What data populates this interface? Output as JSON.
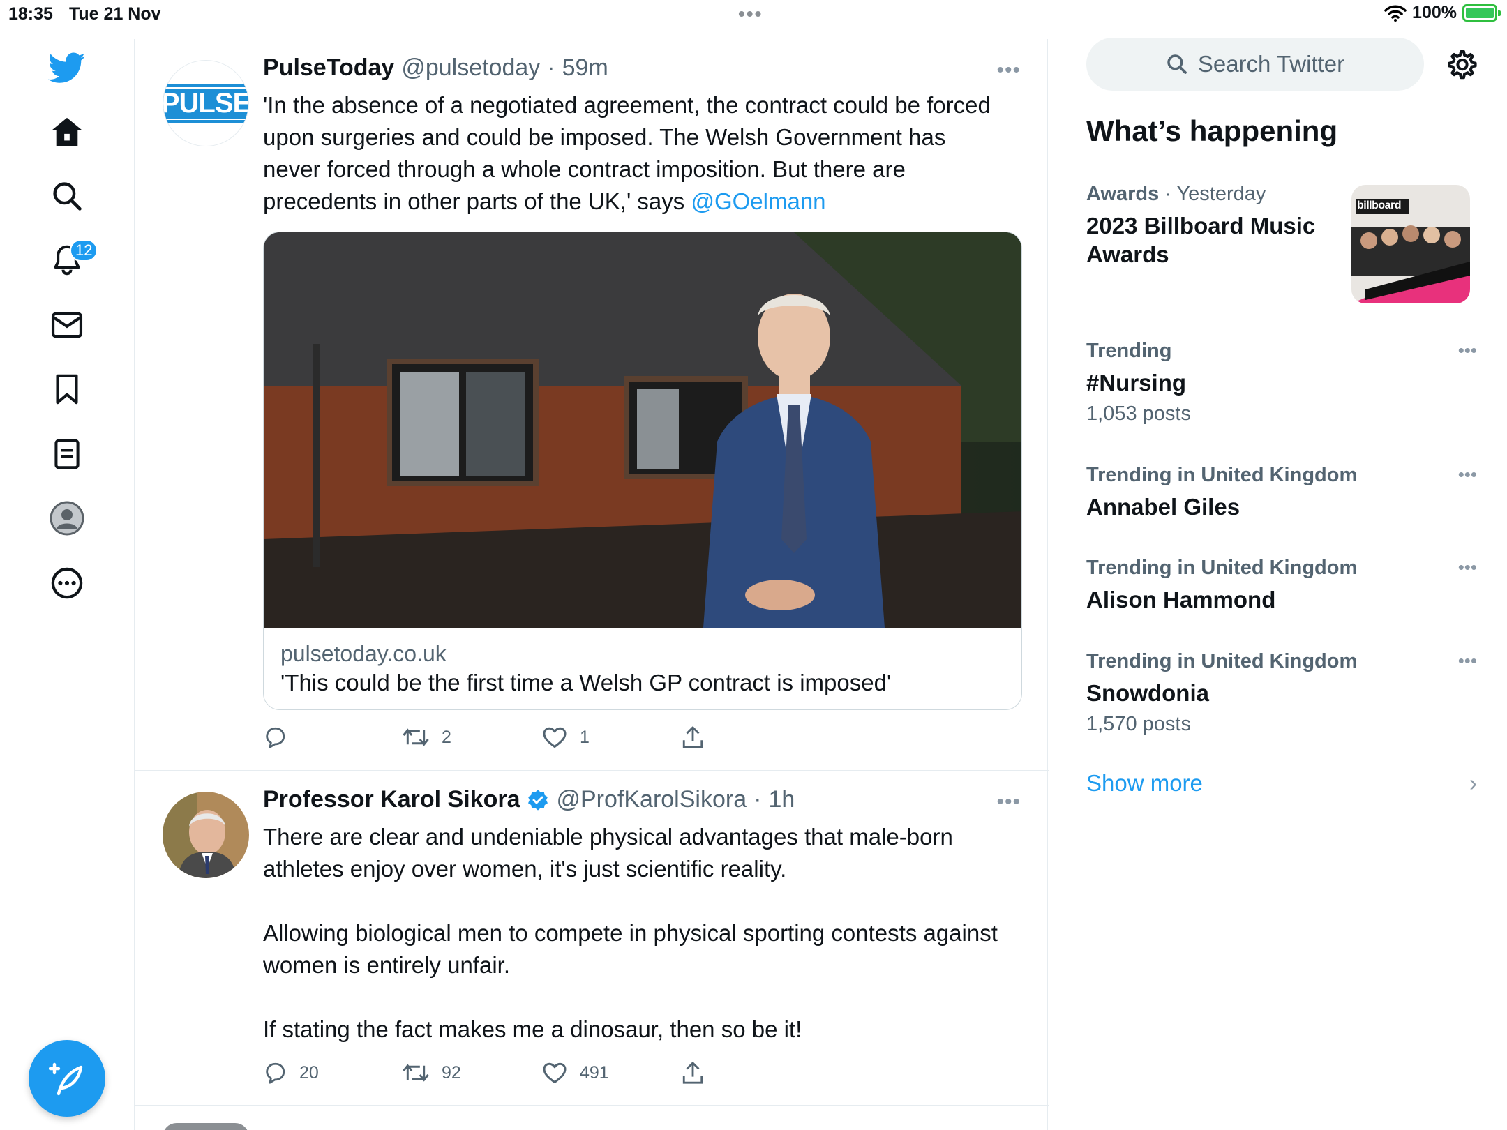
{
  "status_bar": {
    "time": "18:35",
    "date": "Tue 21 Nov",
    "battery": "100%"
  },
  "nav": {
    "notifications_badge": "12"
  },
  "tweets": [
    {
      "name": "PulseToday",
      "handle": "@pulsetoday",
      "time": "59m",
      "avatar_text": "PULSE",
      "text": "'In the absence of a negotiated agreement, the contract could be forced upon surgeries and could be imposed. The Welsh Government has never forced through a whole contract imposition. But there are precedents in other parts of the UK,' says ",
      "mention": "@GOelmann",
      "card_domain": "pulsetoday.co.uk",
      "card_title": "'This could be the first time a Welsh GP contract is imposed'",
      "replies": "",
      "retweets": "2",
      "likes": "1"
    },
    {
      "name": "Professor Karol Sikora",
      "handle": "@ProfKarolSikora",
      "time": "1h",
      "para1": "There are clear and undeniable physical advantages that male-born athletes enjoy over women, it's just scientific reality.",
      "para2": "Allowing biological men to compete in physical sporting contests against women is entirely unfair.",
      "para3": "If stating the fact makes me a dinosaur, then so be it!",
      "replies": "20",
      "retweets": "92",
      "likes": "491"
    }
  ],
  "sidebar": {
    "search_placeholder": "Search Twitter",
    "title": "What’s happening",
    "trends": [
      {
        "category": "Awards",
        "when": "Yesterday",
        "title": "2023 Billboard Music Awards",
        "thumb_text": "billboard"
      },
      {
        "category": "Trending",
        "title": "#Nursing",
        "count": "1,053 posts"
      },
      {
        "category": "Trending in United Kingdom",
        "title": "Annabel Giles"
      },
      {
        "category": "Trending in United Kingdom",
        "title": "Alison Hammond"
      },
      {
        "category": "Trending in United Kingdom",
        "title": "Snowdonia",
        "count": "1,570 posts"
      }
    ],
    "show_more": "Show more"
  },
  "colors": {
    "accent": "#1d9bf0",
    "text": "#0f1419",
    "muted": "#536471",
    "border": "#e6ecf0"
  }
}
